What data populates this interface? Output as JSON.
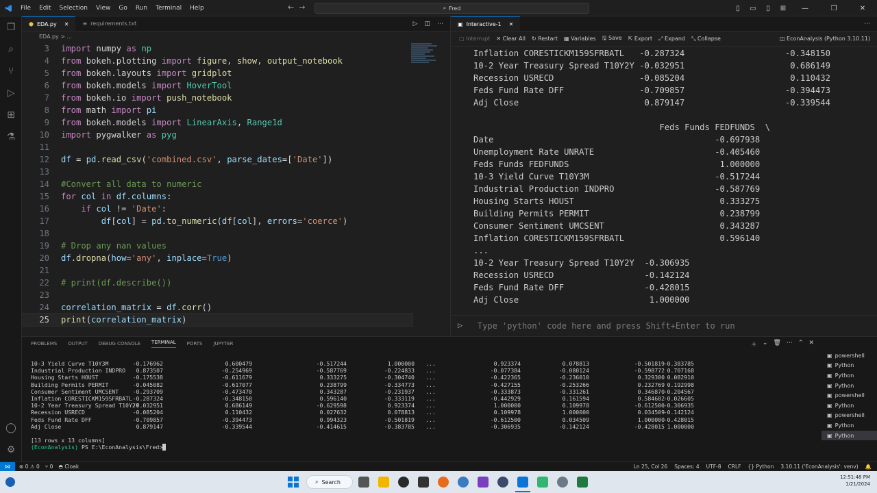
{
  "titlebar": {
    "menu": [
      "File",
      "Edit",
      "Selection",
      "View",
      "Go",
      "Run",
      "Terminal",
      "Help"
    ],
    "search": "Fred"
  },
  "editor": {
    "tabs": [
      {
        "label": "EDA.py",
        "active": true
      },
      {
        "label": "requirements.txt",
        "active": false
      }
    ],
    "breadcrumb": "EDA.py > ...",
    "lines": [
      {
        "n": "3",
        "code": [
          [
            "k",
            "import"
          ],
          [
            "d",
            " numpy "
          ],
          [
            "k",
            "as"
          ],
          [
            "d",
            " "
          ],
          [
            "t",
            "np"
          ]
        ]
      },
      {
        "n": "4",
        "code": [
          [
            "k",
            "from"
          ],
          [
            "d",
            " bokeh.plotting "
          ],
          [
            "k",
            "import"
          ],
          [
            "d",
            " "
          ],
          [
            "f",
            "figure"
          ],
          [
            "d",
            ", "
          ],
          [
            "f",
            "show"
          ],
          [
            "d",
            ", "
          ],
          [
            "f",
            "output_notebook"
          ]
        ]
      },
      {
        "n": "5",
        "code": [
          [
            "k",
            "from"
          ],
          [
            "d",
            " bokeh.layouts "
          ],
          [
            "k",
            "import"
          ],
          [
            "d",
            " "
          ],
          [
            "f",
            "gridplot"
          ]
        ]
      },
      {
        "n": "6",
        "code": [
          [
            "k",
            "from"
          ],
          [
            "d",
            " bokeh.models "
          ],
          [
            "k",
            "import"
          ],
          [
            "d",
            " "
          ],
          [
            "t",
            "HoverTool"
          ]
        ]
      },
      {
        "n": "7",
        "code": [
          [
            "k",
            "from"
          ],
          [
            "d",
            " bokeh.io "
          ],
          [
            "k",
            "import"
          ],
          [
            "d",
            " "
          ],
          [
            "f",
            "push_notebook"
          ]
        ]
      },
      {
        "n": "8",
        "code": [
          [
            "k",
            "from"
          ],
          [
            "d",
            " math "
          ],
          [
            "k",
            "import"
          ],
          [
            "d",
            " "
          ],
          [
            "v",
            "pi"
          ]
        ]
      },
      {
        "n": "9",
        "code": [
          [
            "k",
            "from"
          ],
          [
            "d",
            " bokeh.models "
          ],
          [
            "k",
            "import"
          ],
          [
            "d",
            " "
          ],
          [
            "t",
            "LinearAxis"
          ],
          [
            "d",
            ", "
          ],
          [
            "t",
            "Range1d"
          ]
        ]
      },
      {
        "n": "10",
        "code": [
          [
            "k",
            "import"
          ],
          [
            "d",
            " pygwalker "
          ],
          [
            "k",
            "as"
          ],
          [
            "d",
            " "
          ],
          [
            "t",
            "pyg"
          ]
        ]
      },
      {
        "n": "11",
        "code": []
      },
      {
        "n": "12",
        "code": [
          [
            "v",
            "df"
          ],
          [
            "d",
            " = "
          ],
          [
            "v",
            "pd"
          ],
          [
            "d",
            "."
          ],
          [
            "f",
            "read_csv"
          ],
          [
            "d",
            "("
          ],
          [
            "s",
            "'combined.csv'"
          ],
          [
            "d",
            ", "
          ],
          [
            "v",
            "parse_dates"
          ],
          [
            "d",
            "=["
          ],
          [
            "s",
            "'Date'"
          ],
          [
            "d",
            "])"
          ]
        ]
      },
      {
        "n": "13",
        "code": []
      },
      {
        "n": "14",
        "code": [
          [
            "c",
            "#Convert all data to numeric"
          ]
        ]
      },
      {
        "n": "15",
        "code": [
          [
            "k",
            "for"
          ],
          [
            "d",
            " "
          ],
          [
            "v",
            "col"
          ],
          [
            "d",
            " "
          ],
          [
            "k",
            "in"
          ],
          [
            "d",
            " "
          ],
          [
            "v",
            "df"
          ],
          [
            "d",
            "."
          ],
          [
            "v",
            "columns"
          ],
          [
            "d",
            ":"
          ]
        ]
      },
      {
        "n": "16",
        "code": [
          [
            "d",
            "    "
          ],
          [
            "k",
            "if"
          ],
          [
            "d",
            " "
          ],
          [
            "v",
            "col"
          ],
          [
            "d",
            " != "
          ],
          [
            "s",
            "'Date'"
          ],
          [
            "d",
            ":"
          ]
        ]
      },
      {
        "n": "17",
        "code": [
          [
            "d",
            "        "
          ],
          [
            "v",
            "df"
          ],
          [
            "d",
            "["
          ],
          [
            "v",
            "col"
          ],
          [
            "d",
            "] = "
          ],
          [
            "v",
            "pd"
          ],
          [
            "d",
            "."
          ],
          [
            "f",
            "to_numeric"
          ],
          [
            "d",
            "("
          ],
          [
            "v",
            "df"
          ],
          [
            "d",
            "["
          ],
          [
            "v",
            "col"
          ],
          [
            "d",
            "], "
          ],
          [
            "v",
            "errors"
          ],
          [
            "d",
            "="
          ],
          [
            "s",
            "'coerce'"
          ],
          [
            "d",
            ")"
          ]
        ]
      },
      {
        "n": "18",
        "code": []
      },
      {
        "n": "19",
        "code": [
          [
            "c",
            "# Drop any nan values"
          ]
        ]
      },
      {
        "n": "20",
        "code": [
          [
            "v",
            "df"
          ],
          [
            "d",
            "."
          ],
          [
            "f",
            "dropna"
          ],
          [
            "d",
            "("
          ],
          [
            "v",
            "how"
          ],
          [
            "d",
            "="
          ],
          [
            "s",
            "'any'"
          ],
          [
            "d",
            ", "
          ],
          [
            "v",
            "inplace"
          ],
          [
            "d",
            "="
          ],
          [
            "b",
            "True"
          ],
          [
            "d",
            ")"
          ]
        ]
      },
      {
        "n": "21",
        "code": []
      },
      {
        "n": "22",
        "code": [
          [
            "c",
            "# print(df.describe())"
          ]
        ]
      },
      {
        "n": "23",
        "code": []
      },
      {
        "n": "24",
        "code": [
          [
            "v",
            "correlation_matrix"
          ],
          [
            "d",
            " = "
          ],
          [
            "v",
            "df"
          ],
          [
            "d",
            "."
          ],
          [
            "f",
            "corr"
          ],
          [
            "d",
            "()"
          ]
        ]
      },
      {
        "n": "25",
        "code": [
          [
            "f",
            "print"
          ],
          [
            "d",
            "("
          ],
          [
            "v",
            "correlation_matrix"
          ],
          [
            "d",
            ")"
          ]
        ]
      }
    ]
  },
  "interactive": {
    "tab_label": "Interactive-1",
    "toolbar": [
      "Interrupt",
      "Clear All",
      "Restart",
      "Variables",
      "Save",
      "Export",
      "Expand",
      "Collapse"
    ],
    "kernel": "EconAnalysis (Python 3.10.11)",
    "output_lines": [
      "Inflation CORESTICKM159SFRBATL   -0.287324                    -0.348150",
      "10-2 Year Treasury Spread T10Y2Y -0.032951                     0.686149",
      "Recession USRECD                 -0.085204                     0.110432",
      "Feds Fund Rate DFF               -0.709857                    -0.394473",
      "Adj Close                         0.879147                    -0.339544",
      "",
      "                                     Feds Funds FEDFUNDS  \\",
      "Date                                            -0.697938",
      "Unemployment Rate UNRATE                        -0.405460",
      "Feds Funds FEDFUNDS                              1.000000",
      "10-3 Yield Curve T10Y3M                         -0.517244",
      "Industrial Production INDPRO                    -0.587769",
      "Housing Starts HOUST                             0.333275",
      "Building Permits PERMIT                          0.238799",
      "Consumer Sentiment UMCSENT                       0.343287",
      "Inflation CORESTICKM159SFRBATL                   0.596140",
      "...",
      "10-2 Year Treasury Spread T10Y2Y  -0.306935",
      "Recession USRECD                  -0.142124",
      "Feds Fund Rate DFF                -0.428015",
      "Adj Close                          1.000000"
    ],
    "input_placeholder": "Type 'python' code here and press Shift+Enter to run"
  },
  "panel": {
    "tabs": [
      "PROBLEMS",
      "OUTPUT",
      "DEBUG CONSOLE",
      "TERMINAL",
      "PORTS",
      "JUPYTER"
    ],
    "active_tab": "TERMINAL",
    "terminal_rows": [
      [
        "10-3 Yield Curve T10Y3M",
        "-0.176962",
        "0.600479",
        "-0.517244",
        "1.000000",
        "...",
        "0.923374",
        "0.078813",
        "-0.501819",
        "-0.383785"
      ],
      [
        "Industrial Production INDPRO",
        "0.873507",
        "-0.254969",
        "-0.587769",
        "-0.224833",
        "...",
        "-0.077384",
        "-0.080124",
        "-0.598772",
        "0.707168"
      ],
      [
        "Housing Starts HOUST",
        "-0.175538",
        "-0.611679",
        "0.333275",
        "-0.304740",
        "...",
        "-0.422365",
        "-0.236010",
        "0.329300",
        "0.082910"
      ],
      [
        "Building Permits PERMIT",
        "-0.045082",
        "-0.617077",
        "0.238799",
        "-0.334773",
        "...",
        "-0.427155",
        "-0.253266",
        "0.232769",
        "0.192998"
      ],
      [
        "Consumer Sentiment UMCSENT",
        "-0.293709",
        "-0.473470",
        "0.343287",
        "-0.231937",
        "...",
        "-0.333873",
        "-0.331261",
        "0.346870",
        "-0.204567"
      ],
      [
        "Inflation CORESTICKM159SFRBATL",
        "-0.287324",
        "-0.348150",
        "0.596140",
        "-0.333119",
        "...",
        "-0.442929",
        "0.161594",
        "0.584602",
        "-0.026605"
      ],
      [
        "10-2 Year Treasury Spread T10Y2Y",
        "-0.032951",
        "0.686149",
        "-0.629598",
        "0.923374",
        "...",
        "1.000000",
        "0.109978",
        "-0.612500",
        "-0.306935"
      ],
      [
        "Recession USRECD",
        "-0.085204",
        "0.110432",
        "0.027632",
        "0.078813",
        "...",
        "0.109978",
        "1.000000",
        "0.034509",
        "-0.142124"
      ],
      [
        "Feds Fund Rate DFF",
        "-0.709857",
        "-0.394473",
        "0.994323",
        "-0.501819",
        "...",
        "-0.612500",
        "0.034509",
        "1.000000",
        "-0.428015"
      ],
      [
        "Adj Close",
        "0.879147",
        "-0.339544",
        "-0.414615",
        "-0.383785",
        "...",
        "-0.306935",
        "-0.142124",
        "-0.428015",
        "1.000000"
      ]
    ],
    "summary": "[13 rows x 13 columns]",
    "prompt_env": "(EconAnalysis)",
    "prompt_path": " PS E:\\EconAnalysis\\Fred>",
    "terminals": [
      {
        "label": "powershell",
        "sel": false
      },
      {
        "label": "Python",
        "sel": false
      },
      {
        "label": "Python",
        "sel": false
      },
      {
        "label": "Python",
        "sel": false
      },
      {
        "label": "powershell",
        "sel": false
      },
      {
        "label": "Python",
        "sel": false
      },
      {
        "label": "powershell",
        "sel": false
      },
      {
        "label": "Python",
        "sel": false
      },
      {
        "label": "Python",
        "sel": true
      }
    ]
  },
  "statusbar": {
    "errors": "0",
    "warnings": "0",
    "ports": "0",
    "cloak": "Cloak",
    "position": "Ln 25, Col 26",
    "spaces": "Spaces: 4",
    "encoding": "UTF-8",
    "eol": "CRLF",
    "language": "Python",
    "interpreter": "3.10.11 ('EconAnalysis': venv)"
  },
  "taskbar": {
    "search": "Search",
    "time": "12:51:48 PM",
    "date": "1/21/2024"
  },
  "colors": {
    "accent": "#0078d4",
    "keyword": "#c586c0",
    "function": "#dcdcaa",
    "string": "#ce9178",
    "comment": "#6a9955"
  }
}
